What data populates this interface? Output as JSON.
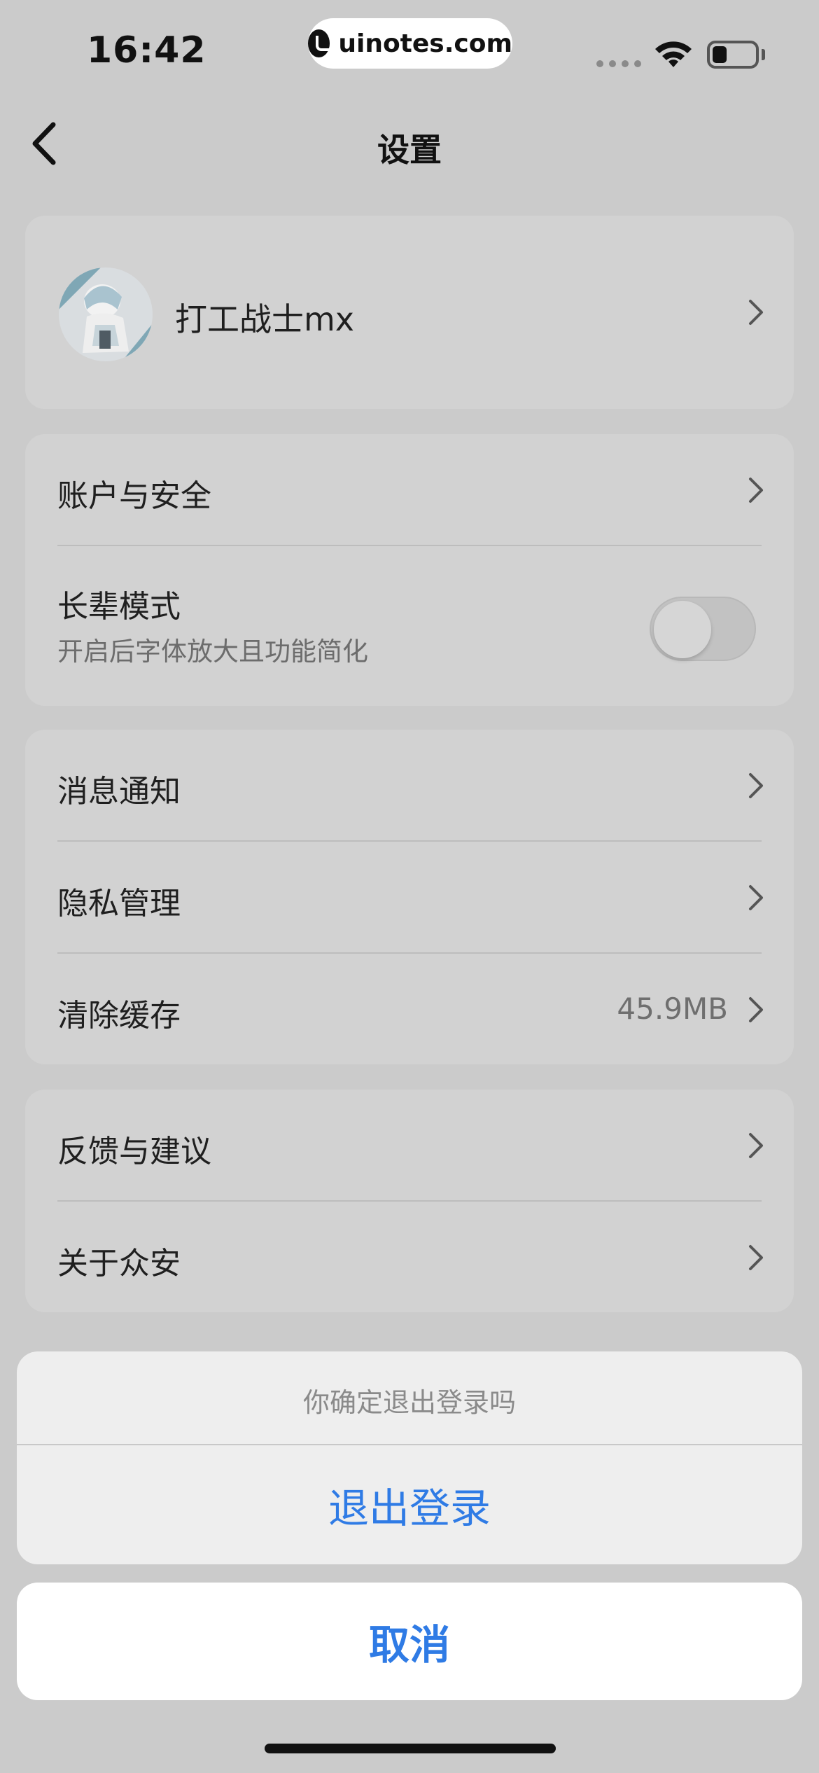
{
  "status_bar": {
    "time": "16:42",
    "watermark": "uinotes.com",
    "icons": [
      "signal-icon",
      "wifi-icon",
      "battery-icon"
    ]
  },
  "nav": {
    "title": "设置",
    "back_icon": "chevron-left-icon"
  },
  "profile": {
    "name": "打工战士mx"
  },
  "account_section": {
    "account_security": "账户与安全",
    "elder_mode": {
      "label": "长辈模式",
      "description": "开启后字体放大且功能简化",
      "enabled": false
    }
  },
  "general_section": {
    "notifications": "消息通知",
    "privacy": "隐私管理",
    "clear_cache": {
      "label": "清除缓存",
      "value": "45.9MB"
    }
  },
  "about_section": {
    "feedback": "反馈与建议",
    "about": "关于众安"
  },
  "action_sheet": {
    "message": "你确定退出登录吗",
    "logout": "退出登录",
    "cancel": "取消"
  },
  "colors": {
    "accent": "#2f7be5",
    "background": "#cbcbcb",
    "card": "#d2d2d2"
  }
}
